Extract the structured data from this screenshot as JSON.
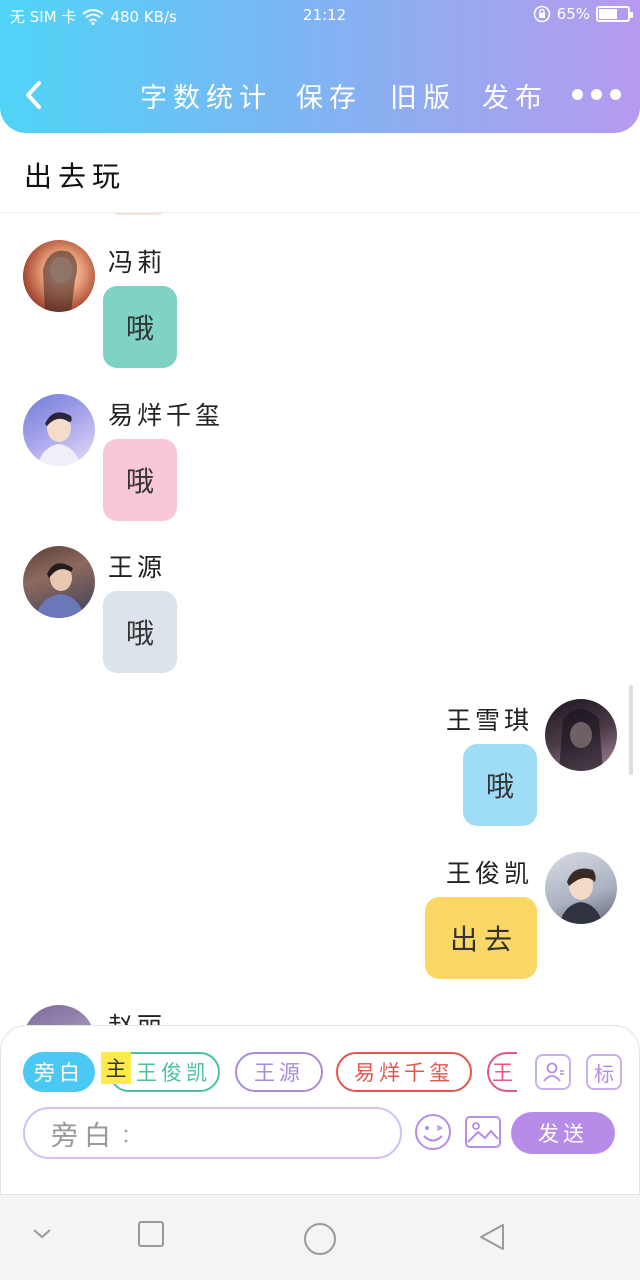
{
  "status_bar": {
    "carrier": "无 SIM 卡",
    "speed": "480 KB/s",
    "time": "21:12",
    "battery": "65%",
    "battery_level": 0.65
  },
  "header": {
    "back_icon": "chevron-left-icon",
    "actions": [
      "字数统计",
      "保存",
      "旧版",
      "发布"
    ],
    "more_icon": "more-dots-icon"
  },
  "story_title": "出去玩",
  "messages": [
    {
      "speaker": "冯莉",
      "text": "哦",
      "side": "left",
      "bubble_color": "#7ed3c4"
    },
    {
      "speaker": "易烊千玺",
      "text": "哦",
      "side": "left",
      "bubble_color": "#f9c8d6"
    },
    {
      "speaker": "王源",
      "text": "哦",
      "side": "left",
      "bubble_color": "#dde3ea"
    },
    {
      "speaker": "王雪琪",
      "text": "哦",
      "side": "right",
      "bubble_color": "#9fdcf6"
    },
    {
      "speaker": "王俊凯",
      "text": "出去",
      "side": "right",
      "bubble_color": "#fbd865"
    },
    {
      "speaker": "赵丽",
      "text": "",
      "side": "left",
      "bubble_color": ""
    }
  ],
  "composer": {
    "chips": [
      {
        "label": "旁白",
        "color": "#4cc8f5",
        "active": true
      },
      {
        "label": "王俊凯",
        "color": "#48c2a3",
        "active": false
      },
      {
        "label": "王源",
        "color": "#a98bd9",
        "active": false
      },
      {
        "label": "易烊千玺",
        "color": "#e2574c",
        "active": false
      },
      {
        "label": "王",
        "color": "#e2587f",
        "active": false
      }
    ],
    "main_badge": "主",
    "side_buttons": {
      "avatar_icon": "person-card-icon",
      "tag_label": "标"
    },
    "input_label": "旁白",
    "input_placeholder": "：",
    "emoji_icon": "emoji-icon",
    "image_icon": "image-icon",
    "send_label": "发送"
  },
  "system_nav": [
    "chevron-down-icon",
    "square-icon",
    "circle-icon",
    "triangle-back-icon"
  ]
}
